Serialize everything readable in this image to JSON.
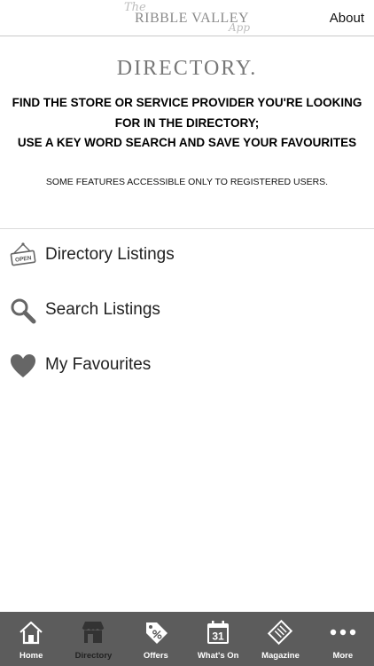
{
  "header": {
    "logo": {
      "the": "The",
      "main": "RIBBLE VALLEY",
      "app": "App"
    },
    "about_label": "About"
  },
  "page_title": "DIRECTORY.",
  "intro_lines": [
    "FIND THE STORE OR SERVICE PROVIDER YOU'RE LOOKING",
    "FOR IN THE DIRECTORY;",
    "USE A KEY WORD SEARCH AND SAVE YOUR FAVOURITES"
  ],
  "note": "SOME FEATURES ACCESSIBLE ONLY TO REGISTERED USERS.",
  "menu": [
    {
      "label": "Directory Listings",
      "icon": "open-sign-icon",
      "sign_text": "OPEN"
    },
    {
      "label": "Search Listings",
      "icon": "search-icon"
    },
    {
      "label": "My Favourites",
      "icon": "heart-icon"
    }
  ],
  "tabs": [
    {
      "label": "Home",
      "icon": "home-icon"
    },
    {
      "label": "Directory",
      "icon": "store-icon",
      "active": true
    },
    {
      "label": "Offers",
      "icon": "offer-tag-icon"
    },
    {
      "label": "What's On",
      "icon": "calendar-icon",
      "calendar_day": "31"
    },
    {
      "label": "Magazine",
      "icon": "magazine-icon"
    },
    {
      "label": "More",
      "icon": "more-icon"
    }
  ],
  "colors": {
    "tabbar_bg": "#5c5c5c",
    "tab_active": "#222222",
    "tab_inactive": "#ffffff",
    "icon_gray": "#666666"
  }
}
